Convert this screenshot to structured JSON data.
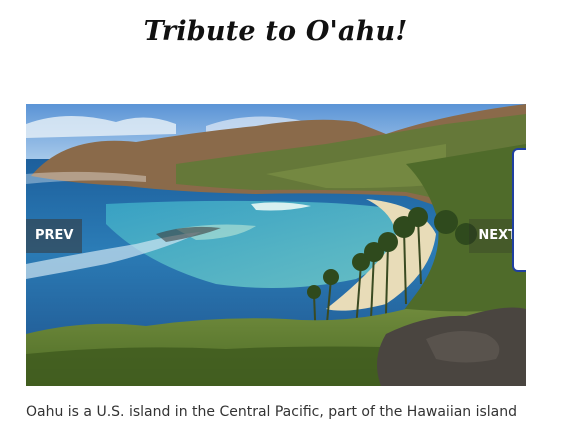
{
  "page": {
    "title": "Tribute to O'ahu!"
  },
  "slider": {
    "prev_label": "PREV",
    "next_label": "NEXT",
    "image": {
      "subject": "Hanauma Bay coastal landscape"
    }
  },
  "description": {
    "text": "Oahu is a U.S. island in the Central Pacific, part of the Hawaiian island"
  },
  "colors": {
    "page_background": "#ffffff",
    "title_text": "#111111",
    "control_background": "#555555",
    "control_text": "#ffffff",
    "edge_widget_border": "#1f3fa0"
  }
}
